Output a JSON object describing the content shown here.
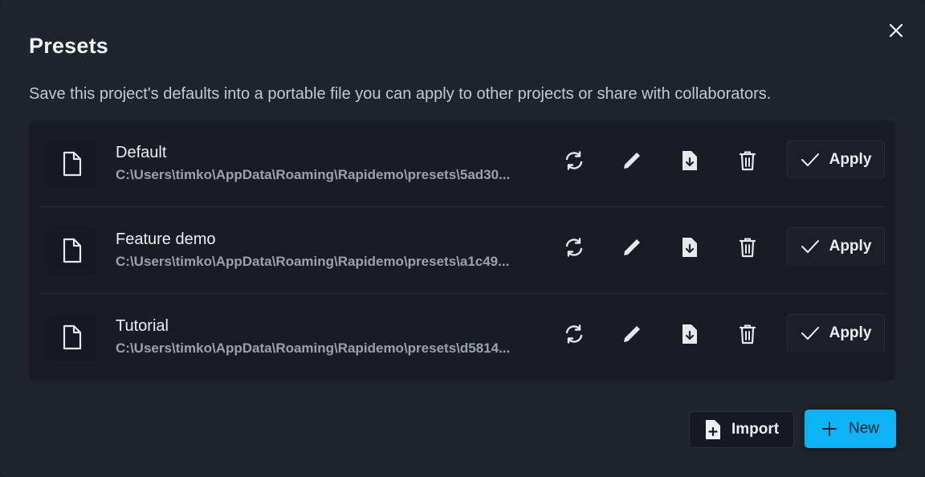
{
  "dialog": {
    "title": "Presets",
    "subtitle": "Save this project's defaults into a portable file you can apply to other projects or share with collaborators."
  },
  "presets": [
    {
      "name": "Default",
      "path": "C:\\Users\\timko\\AppData\\Roaming\\Rapidemo\\presets\\5ad30..."
    },
    {
      "name": "Feature demo",
      "path": "C:\\Users\\timko\\AppData\\Roaming\\Rapidemo\\presets\\a1c49..."
    },
    {
      "name": "Tutorial",
      "path": "C:\\Users\\timko\\AppData\\Roaming\\Rapidemo\\presets\\d5814..."
    }
  ],
  "actions": {
    "apply_label": "Apply",
    "import_label": "Import",
    "new_label": "New"
  },
  "icons": {
    "close": "close-icon",
    "file": "file-icon",
    "sync": "sync-icon",
    "edit": "pencil-icon",
    "export": "file-download-icon",
    "delete": "trash-icon",
    "check": "check-icon",
    "import": "file-plus-icon",
    "plus": "plus-icon"
  },
  "colors": {
    "accent": "#0db4f5",
    "background": "#1f232c",
    "panel": "#191c23"
  }
}
